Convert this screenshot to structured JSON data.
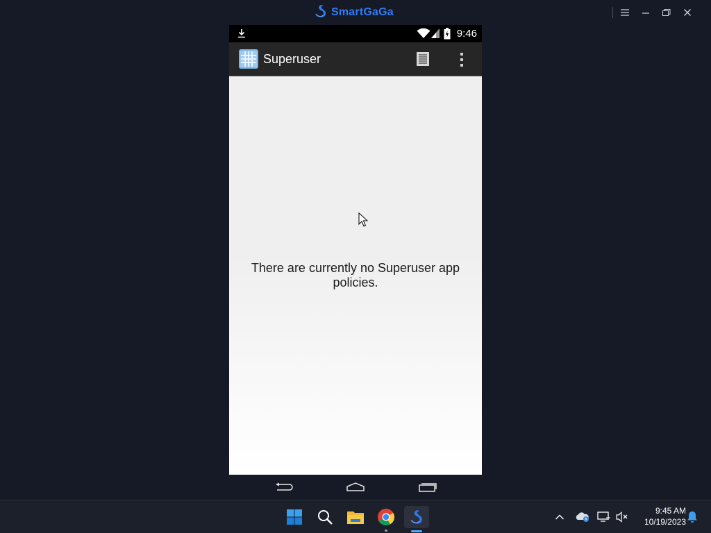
{
  "emulator": {
    "brand": "SmartGaGa",
    "accent": "#2e7cf6"
  },
  "phone": {
    "status_bar": {
      "time": "9:46",
      "icons": [
        "download-icon",
        "wifi-icon",
        "signal-icon",
        "battery-icon"
      ]
    },
    "action_bar": {
      "title": "Superuser",
      "icons": [
        "superuser-app-icon",
        "log-icon",
        "overflow-menu-icon"
      ]
    },
    "content": {
      "message": "There are currently no Superuser app policies."
    },
    "nav_bar": {
      "buttons": [
        "back-icon",
        "home-icon",
        "recents-icon"
      ]
    }
  },
  "taskbar": {
    "pinned": [
      "windows-start-icon",
      "search-icon",
      "file-explorer-icon",
      "chrome-icon",
      "smartgaga-icon"
    ],
    "tray": [
      "chevron-up-icon",
      "onedrive-icon",
      "network-icon",
      "volume-muted-icon",
      "notification-bell-icon"
    ],
    "clock": {
      "time": "9:45 AM",
      "date": "10/19/2023"
    }
  }
}
